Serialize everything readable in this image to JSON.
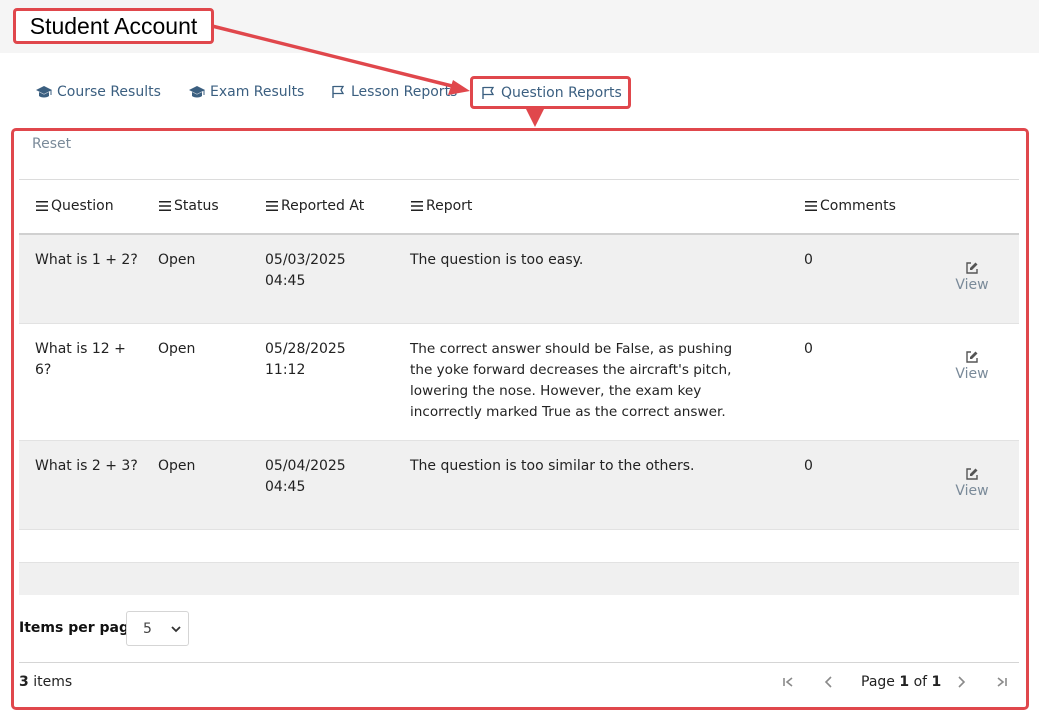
{
  "app": {
    "title": "Student Account"
  },
  "tabs": [
    {
      "label": "Course Results",
      "icon": "graduation-cap-icon"
    },
    {
      "label": "Exam Results",
      "icon": "graduation-cap-icon"
    },
    {
      "label": "Lesson Reports",
      "icon": "flag-icon"
    },
    {
      "label": "Question Reports",
      "icon": "flag-icon",
      "active": true
    }
  ],
  "toolbar": {
    "reset_label": "Reset"
  },
  "table": {
    "columns": [
      "Question",
      "Status",
      "Reported At",
      "Report",
      "Comments"
    ],
    "view_label": "View",
    "rows": [
      {
        "question": "What is 1 + 2?",
        "status": "Open",
        "reported_date": "05/03/2025",
        "reported_time": "04:45",
        "report": "The question is too easy.",
        "comments": "0"
      },
      {
        "question": "What is 12 + 6?",
        "status": "Open",
        "reported_date": "05/28/2025",
        "reported_time": "11:12",
        "report": "The correct answer should be False, as pushing the yoke forward decreases the aircraft's pitch, lowering the nose. However, the exam key incorrectly marked True as the correct answer.",
        "comments": "0"
      },
      {
        "question": "What is 2 + 3?",
        "status": "Open",
        "reported_date": "05/04/2025",
        "reported_time": "04:45",
        "report": "The question is too similar to the others.",
        "comments": "0"
      }
    ]
  },
  "pagination": {
    "items_per_page_label": "Items per page:",
    "items_per_page_value": "5",
    "total_count": "3",
    "total_suffix": "items",
    "page_prefix": "Page",
    "current_page": "1",
    "page_of": "of",
    "total_pages": "1"
  },
  "colors": {
    "annotation": "#e0474c",
    "link": "#3b5f80",
    "muted": "#7a8a99",
    "row_shade": "#f0f0f0"
  }
}
